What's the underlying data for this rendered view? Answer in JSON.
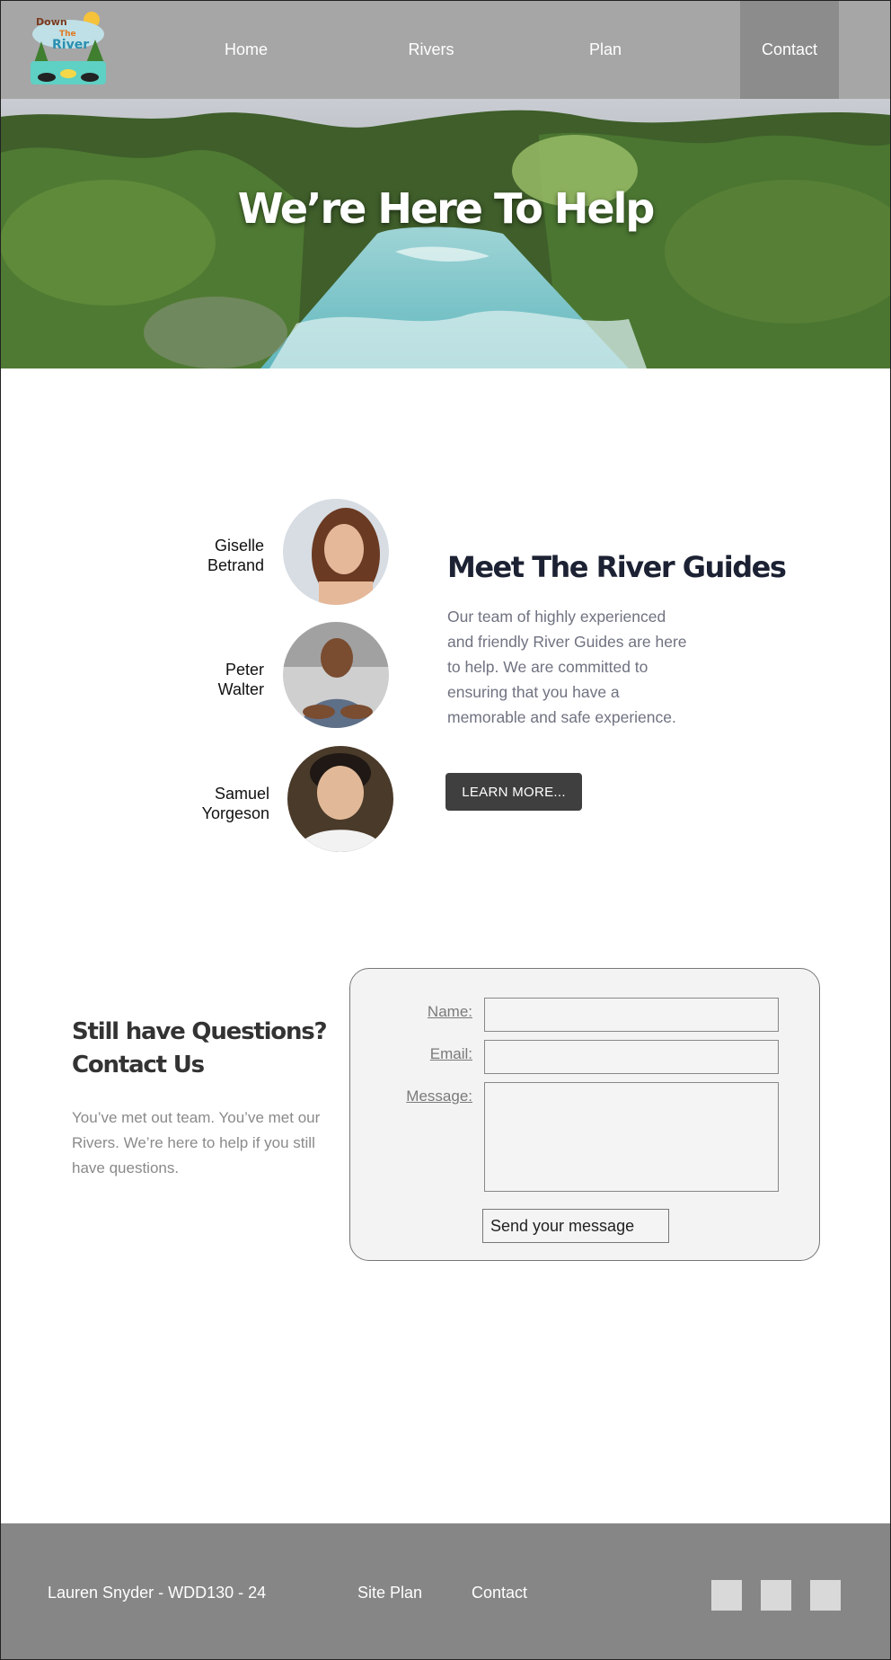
{
  "nav": {
    "logo_text": [
      "Down",
      "The",
      "River"
    ],
    "items": [
      {
        "label": "Home",
        "active": false
      },
      {
        "label": "Rivers",
        "active": false
      },
      {
        "label": "Plan",
        "active": false
      },
      {
        "label": "Contact",
        "active": true
      }
    ],
    "colors": {
      "bar": "#a6a6a6",
      "active": "#8c8c8c"
    }
  },
  "hero": {
    "title": "We’re Here To Help"
  },
  "guides": {
    "people": [
      {
        "name_line1": "Giselle",
        "name_line2": "Betrand"
      },
      {
        "name_line1": "Peter",
        "name_line2": "Walter"
      },
      {
        "name_line1": "Samuel",
        "name_line2": "Yorgeson"
      }
    ],
    "title": "Meet The River Guides",
    "body": "Our team of highly experienced and friendly River Guides are here to help. We are committed to ensuring that you have a memorable and safe experience.",
    "button": "LEARN MORE..."
  },
  "contact": {
    "title_line1": "Still have Questions?",
    "title_line2": "Contact Us",
    "body": "You’ve met out team. You’ve met our Rivers. We’re here to help if you still have questions.",
    "form": {
      "name_label": "Name:",
      "email_label": "Email:",
      "message_label": "Message:",
      "name_value": "",
      "email_value": "",
      "message_value": "",
      "submit": "Send your message"
    }
  },
  "footer": {
    "credit": "Lauren Snyder - WDD130 - 24",
    "links": [
      "Site Plan",
      "Contact"
    ],
    "social_icons": [
      "social-icon-1",
      "social-icon-2",
      "social-icon-3"
    ]
  }
}
